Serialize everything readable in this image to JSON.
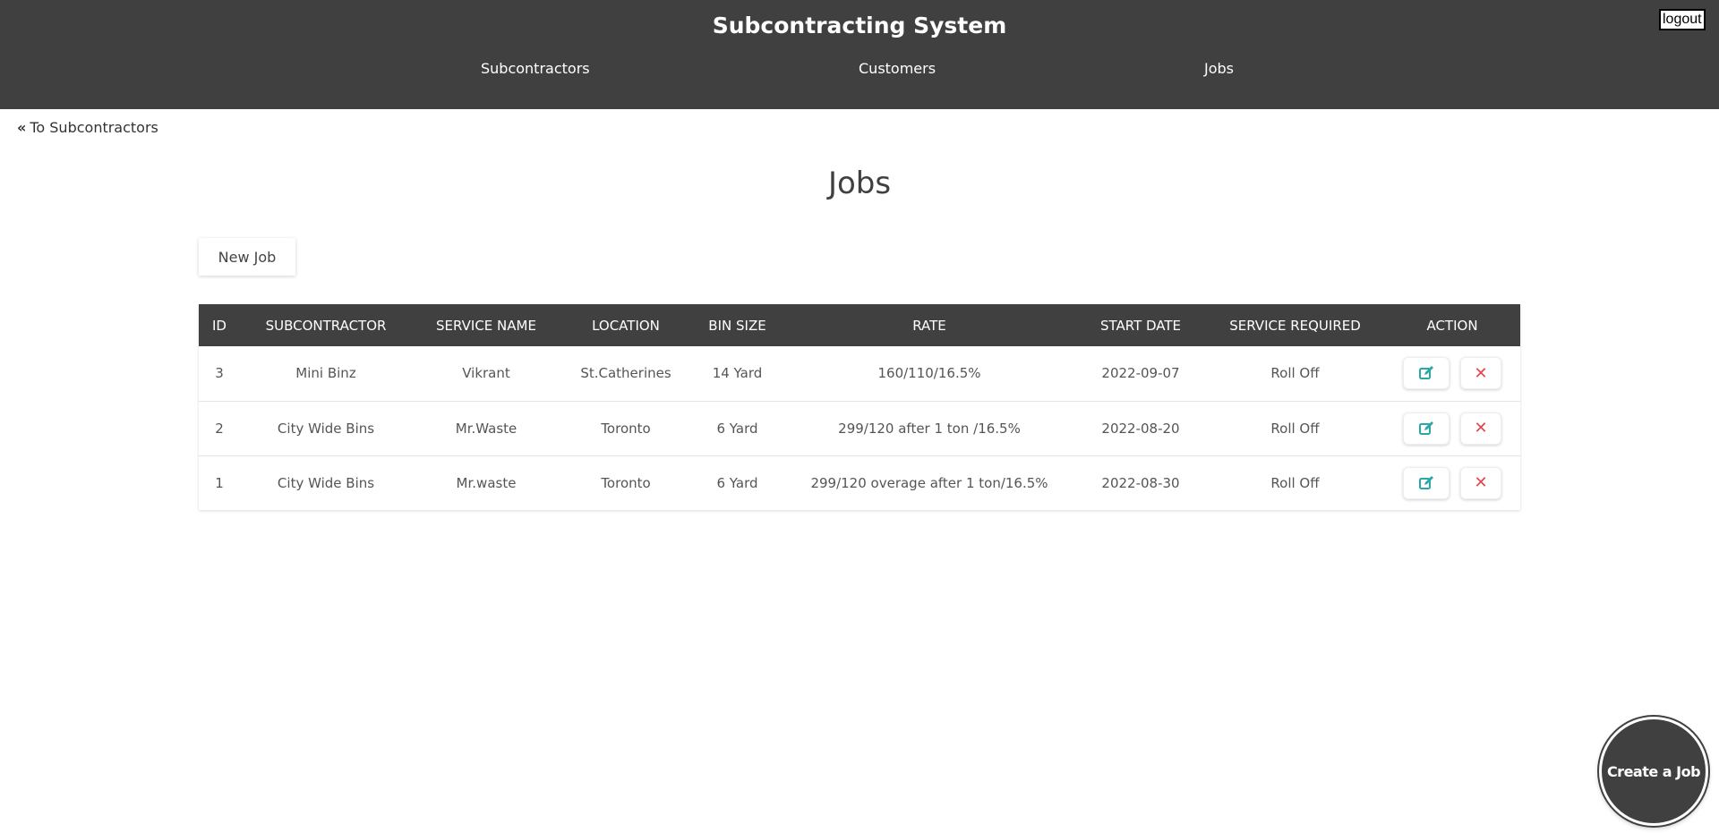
{
  "header": {
    "title": "Subcontracting System",
    "nav": [
      "Subcontractors",
      "Customers",
      "Jobs"
    ],
    "logout_label": "logout"
  },
  "back_link": {
    "icon": "double-chevron-left-icon",
    "label": "To Subcontractors"
  },
  "page_title": "Jobs",
  "new_job_label": "New Job",
  "table": {
    "columns": [
      "ID",
      "SUBCONTRACTOR",
      "SERVICE NAME",
      "LOCATION",
      "BIN SIZE",
      "RATE",
      "START DATE",
      "SERVICE REQUIRED",
      "ACTION"
    ],
    "rows": [
      [
        "3",
        "Mini Binz",
        "Vikrant",
        "St.Catherines",
        "14 Yard",
        "160/110/16.5%",
        "2022-09-07",
        "Roll Off"
      ],
      [
        "2",
        "City Wide Bins",
        "Mr.Waste",
        "Toronto",
        "6 Yard",
        "299/120 after 1 ton /16.5%",
        "2022-08-20",
        "Roll Off"
      ],
      [
        "1",
        "City Wide Bins",
        "Mr.waste",
        "Toronto",
        "6 Yard",
        "299/120 overage after 1 ton/16.5%",
        "2022-08-30",
        "Roll Off"
      ]
    ],
    "action_icons": [
      "edit-icon",
      "close-icon"
    ]
  },
  "fab_label": "Create a Job",
  "colors": {
    "header_bg": "#404040",
    "edit": "#2aa8a8",
    "delete": "#e0474c"
  }
}
